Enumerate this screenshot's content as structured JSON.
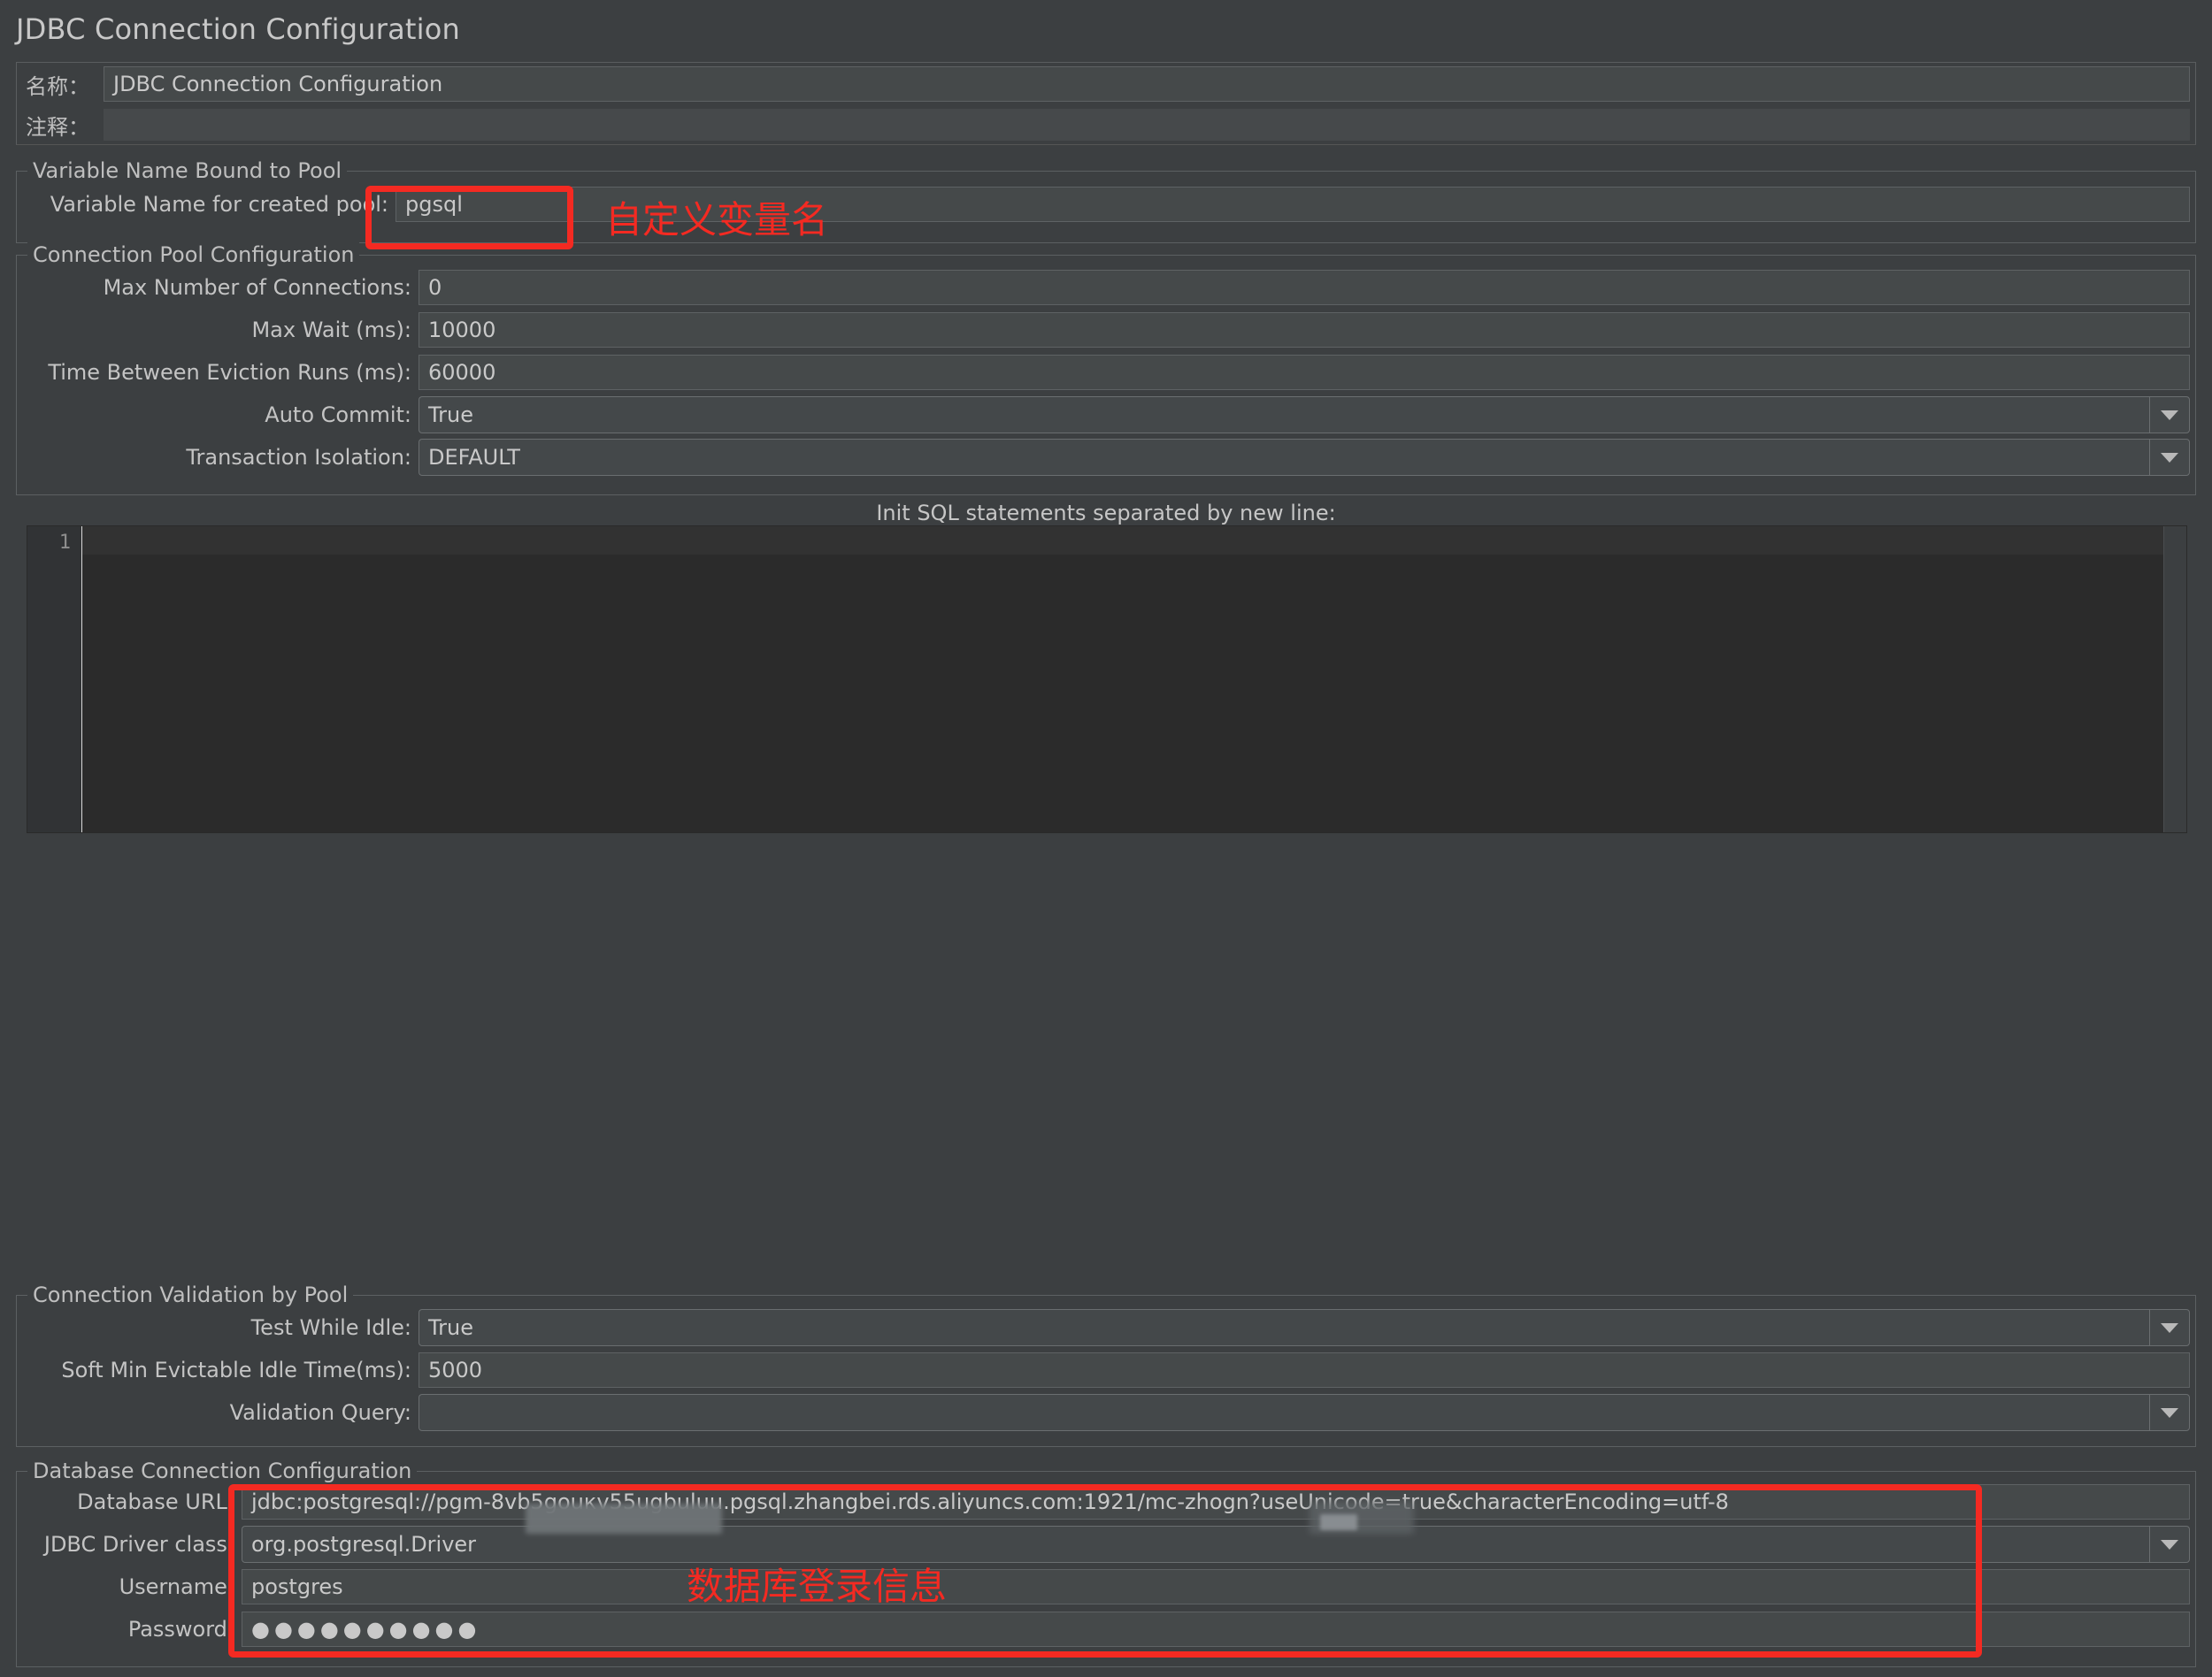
{
  "window": {
    "title": "JDBC Connection Configuration"
  },
  "header": {
    "name_label": "名称：",
    "name_value": "JDBC Connection Configuration",
    "comment_label": "注释：",
    "comment_value": ""
  },
  "variable_group": {
    "title": "Variable Name Bound to Pool",
    "pool_var_label": "Variable Name for created pool:",
    "pool_var_value": "pgsql"
  },
  "pool_group": {
    "title": "Connection Pool Configuration",
    "rows": [
      {
        "label": "Max Number of Connections:",
        "value": "0",
        "type": "text"
      },
      {
        "label": "Max Wait (ms):",
        "value": "10000",
        "type": "text"
      },
      {
        "label": "Time Between Eviction Runs (ms):",
        "value": "60000",
        "type": "text"
      },
      {
        "label": "Auto Commit:",
        "value": "True",
        "type": "combo"
      },
      {
        "label": "Transaction Isolation:",
        "value": "DEFAULT",
        "type": "combo"
      }
    ]
  },
  "init_sql": {
    "label": "Init SQL statements separated by new line:",
    "line_number": "1",
    "content": ""
  },
  "validation_group": {
    "title": "Connection Validation by Pool",
    "rows": [
      {
        "label": "Test While Idle:",
        "value": "True",
        "type": "combo"
      },
      {
        "label": "Soft Min Evictable Idle Time(ms):",
        "value": "5000",
        "type": "text"
      },
      {
        "label": "Validation Query:",
        "value": "",
        "type": "combo"
      }
    ]
  },
  "database_group": {
    "title": "Database Connection Configuration",
    "url_label": "Database URL:",
    "url_value_prefix": "jdbc:postgresql://pgm-8vb5g",
    "url_value_blurred_1": "ouкv55ugbuluu",
    "url_value_mid": ".pgsql.zhangbei.rds.aliyuncs.com:1921/mc-zho",
    "url_value_blurred_2": "g",
    "url_value_suffix": "n?useUnicode=true&characterEncoding=utf-8",
    "driver_label": "JDBC Driver class:",
    "driver_value": "org.postgresql.Driver",
    "username_label": "Username:",
    "username_value": "postgres",
    "password_label": "Password:",
    "password_value": "●●●●●●●●●●"
  },
  "annotations": [
    {
      "name": "variable-name-note",
      "text": "自定义变量名"
    },
    {
      "name": "db-login-note",
      "text": "数据库登录信息"
    }
  ],
  "colors": {
    "background": "#3c3f41",
    "field_background": "#45494a",
    "field_border": "#5e6264",
    "text": "#c9c9c9",
    "annotation_red": "#f42a22",
    "editor_background": "#2b2b2b"
  }
}
